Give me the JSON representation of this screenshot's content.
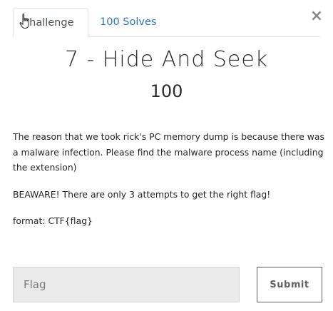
{
  "tabs": {
    "challenge_label": "Challenge",
    "solves_label": "100 Solves"
  },
  "close_label": "×",
  "challenge": {
    "title": "7 - Hide And Seek",
    "points": "100",
    "description": [
      "The reason that we took rick's PC memory dump is because there was a malware infection. Please find the malware process name (including the extension)",
      "BEAWARE! There are only 3 attempts to get the right flag!",
      "format: CTF{flag}"
    ]
  },
  "form": {
    "flag_placeholder": "Flag",
    "flag_value": "",
    "submit_label": "Submit"
  },
  "icons": {
    "cursor": "hand-pointer-icon",
    "close": "close-icon"
  },
  "colors": {
    "link": "#2a76c8",
    "input_bg": "#eaeaea",
    "submit_border": "#5f5f5f"
  }
}
